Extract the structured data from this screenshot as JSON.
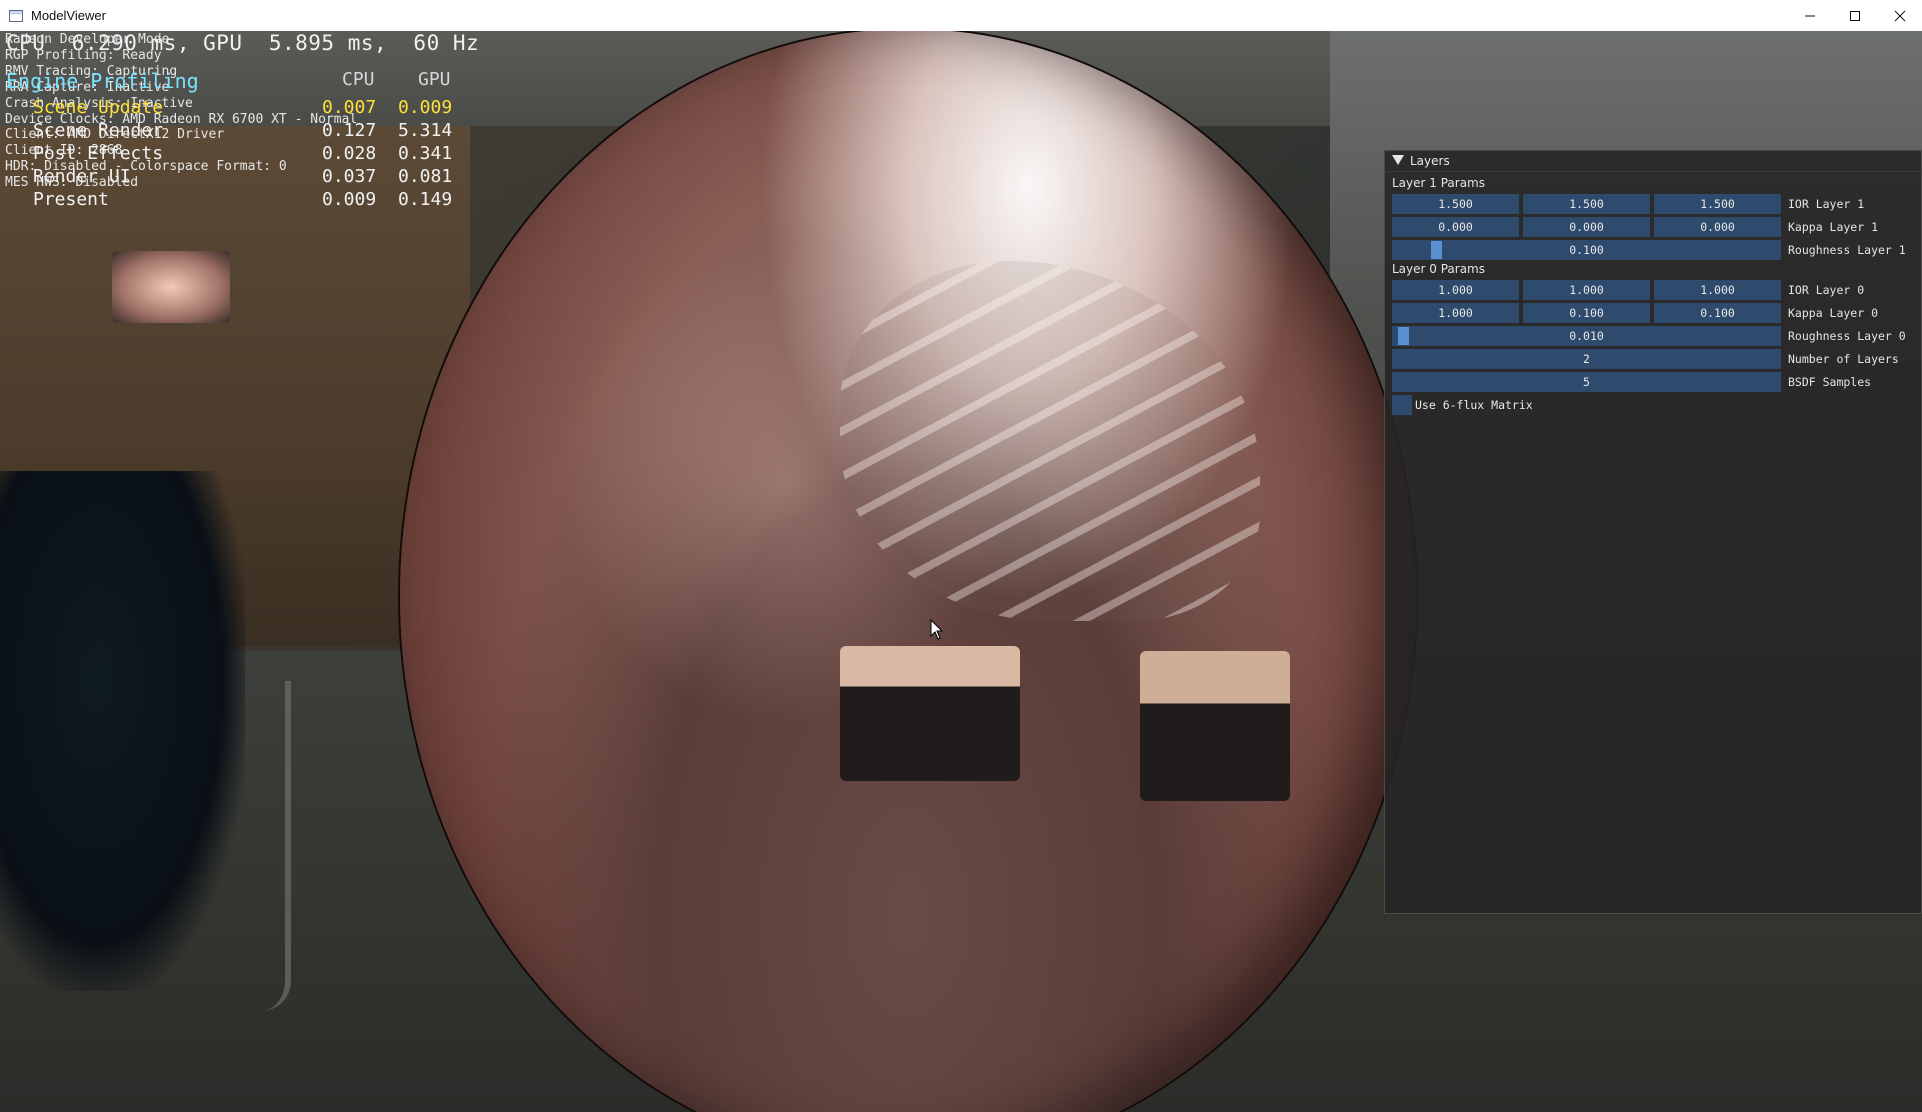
{
  "window": {
    "title": "ModelViewer"
  },
  "overlay": {
    "fps_line": "CPU  6.290 ms, GPU  5.895 ms,  60 Hz",
    "status_lines": [
      "Radeon Developer Mode",
      "RGP Profiling: Ready",
      "RMV Tracing: Capturing",
      "RRA Capture: Inactive",
      "Crash Analysis: Inactive",
      "Device Clocks: AMD Radeon RX 6700 XT - Normal",
      "Client: AMD DirectX12 Driver",
      "Client ID: 2868",
      "HDR: Disabled - Colorspace Format: 0",
      "MES HWS: Disabled"
    ],
    "profiling_title": "Engine Profiling",
    "headers": {
      "cpu": "CPU",
      "gpu": "GPU"
    },
    "rows": [
      {
        "name": "Scene Update",
        "cpu": "0.007",
        "gpu": "0.009",
        "highlight": true
      },
      {
        "name": "Scene Render",
        "cpu": "0.127",
        "gpu": "5.314",
        "highlight": false
      },
      {
        "name": "Post Effects",
        "cpu": "0.028",
        "gpu": "0.341",
        "highlight": false
      },
      {
        "name": "Render UI",
        "cpu": "0.037",
        "gpu": "0.081",
        "highlight": false
      },
      {
        "name": "Present",
        "cpu": "0.009",
        "gpu": "0.149",
        "highlight": false
      }
    ]
  },
  "layers_panel": {
    "title": "Layers",
    "layer1_header": "Layer 1 Params",
    "ior_layer1": {
      "values": [
        "1.500",
        "1.500",
        "1.500"
      ],
      "label": "IOR Layer 1"
    },
    "kappa_layer1": {
      "values": [
        "0.000",
        "0.000",
        "0.000"
      ],
      "label": "Kappa Layer 1"
    },
    "roughness_layer1": {
      "value": "0.100",
      "label": "Roughness Layer 1",
      "fraction": 0.1
    },
    "layer0_header": "Layer 0 Params",
    "ior_layer0": {
      "values": [
        "1.000",
        "1.000",
        "1.000"
      ],
      "label": "IOR Layer 0"
    },
    "kappa_layer0": {
      "values": [
        "1.000",
        "0.100",
        "0.100"
      ],
      "label": "Kappa Layer 0"
    },
    "roughness_layer0": {
      "value": "0.010",
      "label": "Roughness Layer 0",
      "fraction": 0.01
    },
    "num_layers": {
      "value": "2",
      "label": "Number of Layers"
    },
    "bsdf_samples": {
      "value": "5",
      "label": "BSDF Samples"
    },
    "six_flux": {
      "label": "Use 6-flux Matrix",
      "checked": false
    }
  }
}
